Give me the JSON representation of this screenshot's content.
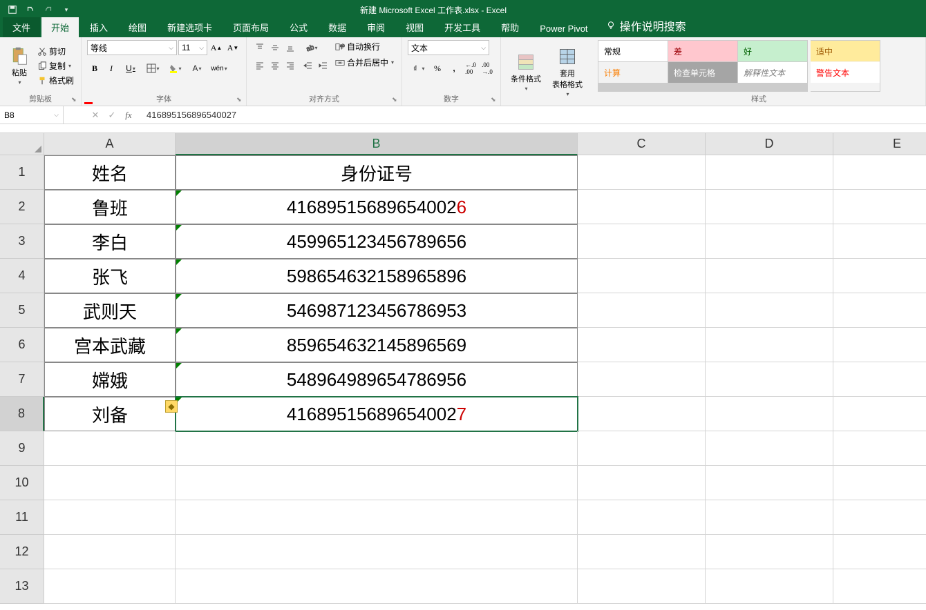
{
  "title": "新建 Microsoft Excel 工作表.xlsx - Excel",
  "tabs": {
    "file": "文件",
    "home": "开始",
    "insert": "插入",
    "draw": "绘图",
    "newtab": "新建选项卡",
    "layout": "页面布局",
    "formulas": "公式",
    "data": "数据",
    "review": "审阅",
    "view": "视图",
    "dev": "开发工具",
    "help": "帮助",
    "pp": "Power Pivot",
    "tell": "操作说明搜索"
  },
  "ribbon": {
    "clipboard": {
      "paste": "粘贴",
      "cut": "剪切",
      "copy": "复制",
      "format_painter": "格式刷",
      "label": "剪贴板"
    },
    "font": {
      "name": "等线",
      "size": "11",
      "bold": "B",
      "italic": "I",
      "underline": "U",
      "ruby": "wén",
      "label": "字体"
    },
    "alignment": {
      "wrap": "自动换行",
      "merge": "合并后居中",
      "label": "对齐方式"
    },
    "number": {
      "format": "文本",
      "label": "数字"
    },
    "cond_format": "条件格式",
    "table_format": "套用\n表格格式",
    "styles": {
      "normal": "常规",
      "bad": "差",
      "good": "好",
      "neutral": "适中",
      "calc": "计算",
      "check": "检查单元格",
      "explain": "解释性文本",
      "warn": "警告文本",
      "label": "样式"
    }
  },
  "name_box": "B8",
  "formula": "416895156896540027",
  "columns": [
    "A",
    "B",
    "C",
    "D",
    "E"
  ],
  "rows": [
    "1",
    "2",
    "3",
    "4",
    "5",
    "6",
    "7",
    "8",
    "9",
    "10",
    "11",
    "12",
    "13"
  ],
  "sheet": {
    "a1": "姓名",
    "b1": "身份证号",
    "a2": "鲁班",
    "b2": "41689515689654002",
    "b2_last": "6",
    "a3": "李白",
    "b3": "459965123456789656",
    "a4": "张飞",
    "b4": "598654632158965896",
    "a5": "武则天",
    "b5": "546987123456786953",
    "a6": "宫本武藏",
    "b6": "859654632145896569",
    "a7": "嫦娥",
    "b7": "548964989654786956",
    "a8": "刘备",
    "b8": "41689515689654002",
    "b8_last": "7"
  },
  "trace_icon": "◆"
}
